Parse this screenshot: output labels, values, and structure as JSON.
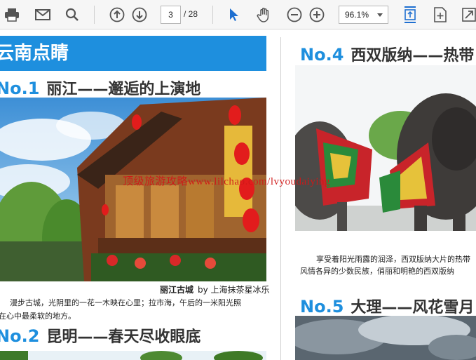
{
  "toolbar": {
    "icons": [
      "print-icon",
      "email-icon",
      "search-icon",
      "prev-page-icon",
      "next-page-icon",
      "select-cursor-icon",
      "hand-tool-icon",
      "zoom-out-icon",
      "zoom-in-icon",
      "fit-page-icon",
      "rotate-icon",
      "fullscreen-icon"
    ],
    "page_current": "3",
    "page_total": "/ 28",
    "zoom": "96.1%",
    "accent": "#1e6fd0"
  },
  "left_page": {
    "banner": "云南点睛",
    "no1": {
      "num": "No.1",
      "title": "丽江——邂逅的上演地"
    },
    "caption_title": "丽江古城",
    "caption_credit": "by 上海抹茶星冰乐",
    "para_line1": "漫步古城，光阴里的一花一木映在心里；拉市海，午后的一米阳光照",
    "para_line2": "在心中最柔软的地方。",
    "no2": {
      "num": "No.2",
      "title": "昆明——春天尽收眼底"
    }
  },
  "right_page": {
    "no4": {
      "num": "No.4",
      "title": "西双版纳——热带"
    },
    "para_line1": "享受着阳光雨露的润泽，西双版纳大片的热带",
    "para_line2": "风情各异的少数民族，俏丽和明艳的西双版纳",
    "no5": {
      "num": "No.5",
      "title": "大理——风花雪月"
    }
  },
  "watermark": "顶级旅游攻略www.lilchao.com/lvyoudaiying",
  "colors": {
    "brand_blue": "#1e8fde",
    "watermark_red": "#d01818"
  }
}
